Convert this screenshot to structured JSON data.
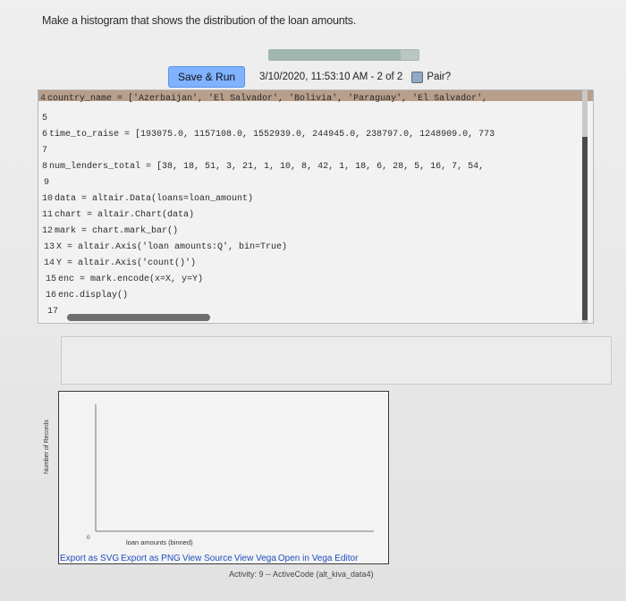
{
  "prompt": "Make a histogram that shows the distribution of the loan amounts.",
  "progress": {
    "fraction": 0.88
  },
  "toolbar": {
    "save_label": "Save & Run",
    "timestamp": "3/10/2020, 11:53:10 AM - 2 of 2",
    "pair_label": "Pair?"
  },
  "code": {
    "lines": [
      {
        "n": "4",
        "text": "country_name = ['Azerbaijan', 'El Salvador', 'Bolivia', 'Paraguay', 'El Salvador',"
      },
      {
        "n": "5",
        "text": ""
      },
      {
        "n": "6",
        "text": "time_to_raise = [193075.0, 1157108.0, 1552939.0, 244945.0, 238797.0, 1248909.0, 773"
      },
      {
        "n": "7",
        "text": ""
      },
      {
        "n": "8",
        "text": "num_lenders_total = [38, 18, 51, 3, 21, 1, 10, 8, 42, 1, 18, 6, 28, 5, 16, 7, 54,"
      },
      {
        "n": "9",
        "text": ""
      },
      {
        "n": "10",
        "text": "data = altair.Data(loans=loan_amount)"
      },
      {
        "n": "11",
        "text": "chart = altair.Chart(data)"
      },
      {
        "n": "12",
        "text": "mark = chart.mark_bar()"
      },
      {
        "n": "13",
        "text": "X = altair.Axis('loan amounts:Q', bin=True)"
      },
      {
        "n": "14",
        "text": "Y = altair.Axis('count()')"
      },
      {
        "n": "15",
        "text": "enc = mark.encode(x=X, y=Y)"
      },
      {
        "n": "16",
        "text": "enc.display()"
      },
      {
        "n": "17",
        "text": ""
      }
    ]
  },
  "chart": {
    "ylabel": "Number of Records",
    "xlabel": "loan amounts (binned)",
    "zero": "0"
  },
  "links": {
    "svg": "Export as SVG",
    "png": "Export as PNG",
    "source": "View Source",
    "vega": "View Vega",
    "open": "Open in Vega Editor"
  },
  "activity": "Activity: 9 -- ActiveCode (alt_kiva_data4)"
}
